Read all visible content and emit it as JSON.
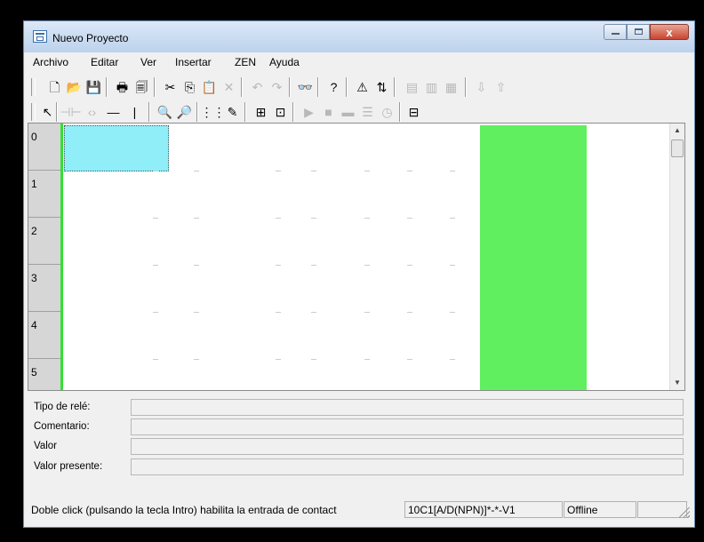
{
  "window": {
    "title": "Nuevo Proyecto",
    "buttons": {
      "close_label": "x"
    }
  },
  "menu": [
    "Archivo",
    "Editar",
    "Ver",
    "Insertar",
    "ZEN",
    "Ayuda"
  ],
  "toolbar1": [
    {
      "name": "new-file-icon",
      "glyph": "🗋"
    },
    {
      "name": "open-folder-icon",
      "glyph": "📂"
    },
    {
      "name": "save-icon",
      "glyph": "💾"
    },
    {
      "name": "print-icon",
      "glyph": "🖶"
    },
    {
      "name": "print-preview-icon",
      "glyph": "🗐"
    },
    {
      "name": "cut-icon",
      "glyph": "✂"
    },
    {
      "name": "copy-icon",
      "glyph": "⎘"
    },
    {
      "name": "paste-icon",
      "glyph": "📋"
    },
    {
      "name": "delete-icon",
      "glyph": "✕"
    },
    {
      "name": "undo-icon",
      "glyph": "↶"
    },
    {
      "name": "redo-icon",
      "glyph": "↷"
    },
    {
      "name": "find-binoculars-icon",
      "glyph": "👓"
    },
    {
      "name": "help-icon",
      "glyph": "?"
    },
    {
      "name": "warning-icon",
      "glyph": "⚠"
    },
    {
      "name": "transfer-icon",
      "glyph": "⇅"
    },
    {
      "name": "monitor-icon",
      "glyph": "▤"
    },
    {
      "name": "compare-icon",
      "glyph": "▥"
    },
    {
      "name": "check-icon",
      "glyph": "▦"
    },
    {
      "name": "download-icon",
      "glyph": "⇩"
    },
    {
      "name": "upload-icon",
      "glyph": "⇧"
    }
  ],
  "toolbar2": [
    {
      "name": "select-pointer-icon",
      "glyph": "↖"
    },
    {
      "name": "contact-icon",
      "glyph": "⊣⊢"
    },
    {
      "name": "contact-nc-icon",
      "glyph": "‹›"
    },
    {
      "name": "horizontal-line-icon",
      "glyph": "—"
    },
    {
      "name": "vertical-line-icon",
      "glyph": "|"
    },
    {
      "name": "zoom-out-icon",
      "glyph": "🔍"
    },
    {
      "name": "zoom-in-icon",
      "glyph": "🔎"
    },
    {
      "name": "grid-icon",
      "glyph": "⋮⋮"
    },
    {
      "name": "comment-icon",
      "glyph": "✎"
    },
    {
      "name": "function-block-icon",
      "glyph": "⊞"
    },
    {
      "name": "edit-block-icon",
      "glyph": "⊡"
    },
    {
      "name": "run-icon",
      "glyph": "▶"
    },
    {
      "name": "stop-icon",
      "glyph": "■"
    },
    {
      "name": "simulate-icon",
      "glyph": "▬"
    },
    {
      "name": "table-icon",
      "glyph": "☰"
    },
    {
      "name": "clock-icon",
      "glyph": "◷"
    },
    {
      "name": "monitor-mode-icon",
      "glyph": "⊟"
    }
  ],
  "ladder": {
    "rows": [
      "0",
      "1",
      "2",
      "3",
      "4",
      "5"
    ]
  },
  "properties": [
    {
      "label": "Tipo de relé:",
      "value": ""
    },
    {
      "label": "Comentario:",
      "value": ""
    },
    {
      "label": "Valor",
      "value": ""
    },
    {
      "label": "Valor presente:",
      "value": ""
    }
  ],
  "status": {
    "message": "Doble click (pulsando la tecla Intro) habilita la entrada de contact",
    "device": "10C1[A/D(NPN)]*-*-V1",
    "mode": "Offline"
  },
  "colors": {
    "selected_cell": "#8feef8",
    "active_column": "#5fef5f",
    "rung_bar": "#33e033"
  }
}
